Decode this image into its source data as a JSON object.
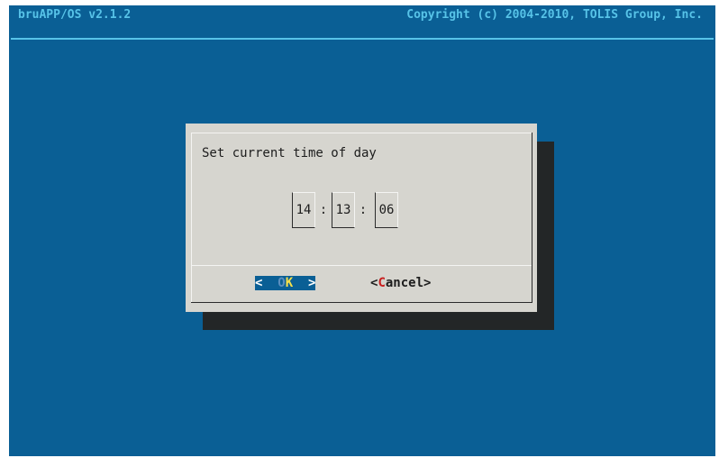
{
  "header": {
    "title": "bruAPP/OS v2.1.2",
    "copyright": "Copyright (c) 2004-2010, TOLIS Group, Inc."
  },
  "dialog": {
    "prompt": "Set current time of day",
    "time": {
      "hours": "14",
      "minutes": "13",
      "seconds": "06",
      "separator": ":"
    },
    "buttons": {
      "ok": {
        "left_bracket": "<",
        "dim_letter": "O",
        "hot_letter": "K",
        "right_bracket": ">"
      },
      "cancel": {
        "left_bracket": "<",
        "hot_letter": "C",
        "rest": "ancel",
        "right_bracket": ">"
      }
    }
  },
  "colors": {
    "background": "#0a5f95",
    "header_text": "#57c3e8",
    "dialog_bg": "#d6d5cf",
    "shadow": "#232627",
    "hotkey_ok": "#f6e04a",
    "hotkey_cancel": "#c81e1e"
  }
}
